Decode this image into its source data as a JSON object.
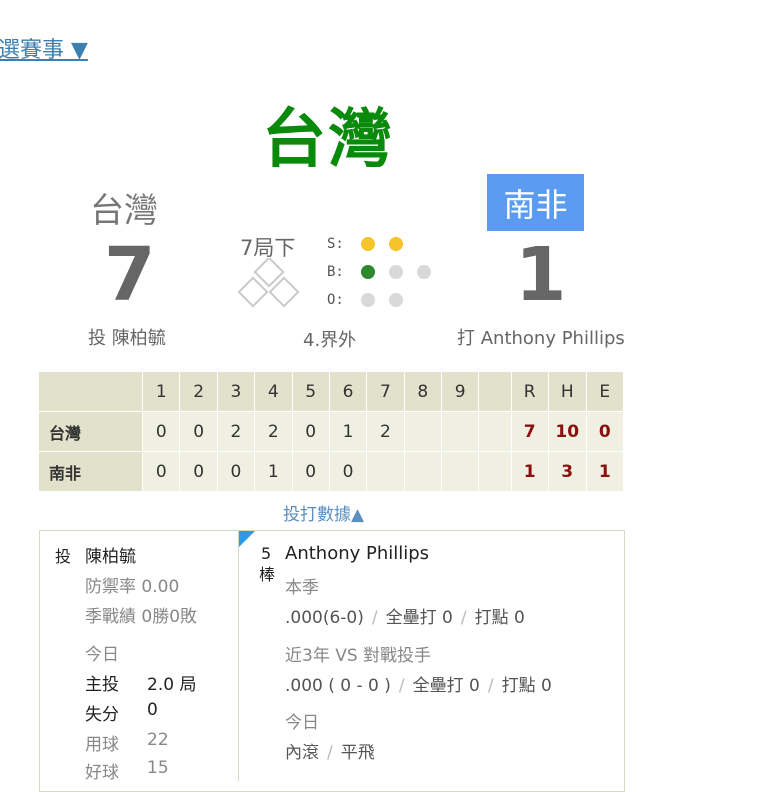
{
  "top_link": "選賽事 ▼",
  "headline_team": "台灣",
  "away": {
    "name": "台灣",
    "score": "7"
  },
  "home": {
    "name": "南非",
    "score": "1"
  },
  "inning": "7局下",
  "sbo": {
    "s_label": "S:",
    "b_label": "B:",
    "o_label": "O:",
    "strikes": 2,
    "balls": 1,
    "outs": 0
  },
  "pitcher_line": "投 陳柏毓",
  "play_result": "4.界外",
  "batter_line": "打 Anthony Phillips",
  "linescore": {
    "headers": [
      "",
      "1",
      "2",
      "3",
      "4",
      "5",
      "6",
      "7",
      "8",
      "9",
      "",
      "R",
      "H",
      "E"
    ],
    "rows": [
      {
        "team": "台灣",
        "innings": [
          "0",
          "0",
          "2",
          "2",
          "0",
          "1",
          "2",
          "",
          "",
          ""
        ],
        "R": "7",
        "H": "10",
        "E": "0"
      },
      {
        "team": "南非",
        "innings": [
          "0",
          "0",
          "0",
          "1",
          "0",
          "0",
          "",
          "",
          "",
          ""
        ],
        "R": "1",
        "H": "3",
        "E": "1"
      }
    ]
  },
  "stats_toggle": "投打數據▲",
  "pitcher_panel": {
    "role": "投",
    "name": "陳柏毓",
    "era": "防禦率 0.00",
    "record": "季戰績 0勝0敗",
    "today_label": "今日",
    "rows": [
      {
        "label": "主投",
        "value": "2.0 局"
      },
      {
        "label": "失分",
        "value": "0"
      },
      {
        "label": "用球",
        "value": "22"
      },
      {
        "label": "好球",
        "value": "15"
      }
    ]
  },
  "batter_panel": {
    "order_num": "5",
    "order_label": "棒",
    "name": "Anthony Phillips",
    "season_label": "本季",
    "season_avg": ".000(6-0)",
    "season_hr": "全壘打 0",
    "season_rbi": "打點 0",
    "vs_label": "近3年 VS 對戰投手",
    "vs_avg": ".000 ( 0 - 0 )",
    "vs_hr": "全壘打 0",
    "vs_rbi": "打點 0",
    "today_label": "今日",
    "today_results": [
      "內滾",
      "平飛"
    ]
  },
  "colors": {
    "headline": "#0a8a0a",
    "home_badge": "#5b9bf2",
    "strike_dot": "#f6c42a",
    "ball_dot": "#2c8a2c",
    "link": "#3d7fb0"
  }
}
